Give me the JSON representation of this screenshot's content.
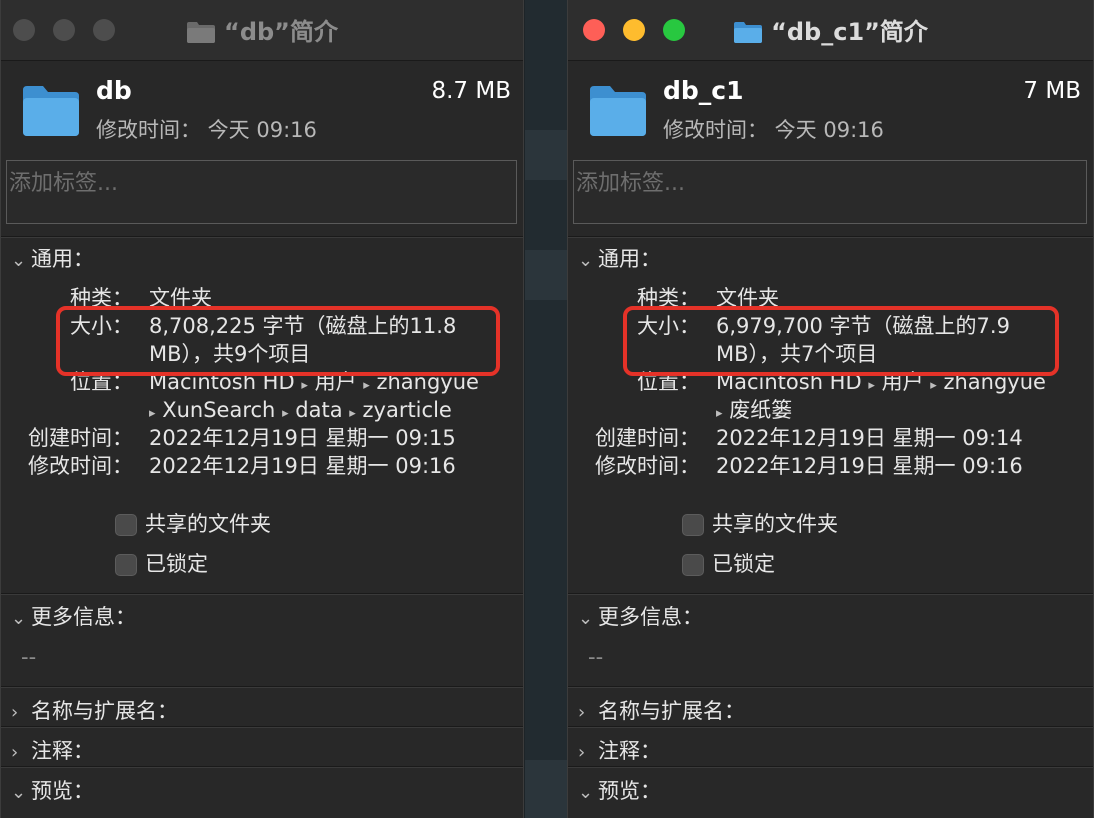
{
  "left": {
    "title": "“db”简介",
    "name": "db",
    "size": "8.7 MB",
    "modified_header": "修改时间： 今天 09:16",
    "tags_placeholder": "添加标签...",
    "general_label": "通用：",
    "kind_label": "种类：",
    "kind_value": "文件夹",
    "size_label": "大小：",
    "size_line1": "8,708,225 字节（磁盘上的11.8",
    "size_line2": "MB），共9个项目",
    "where_label": "位置：",
    "where_line1_a": "Macintosh HD",
    "where_line1_b": "用户",
    "where_line1_c": "zhangyue",
    "where_line2_a": "XunSearch",
    "where_line2_b": "data",
    "where_line2_c": "zyarticle",
    "created_label": "创建时间：",
    "created_value": "2022年12月19日 星期一 09:15",
    "modified_label": "修改时间：",
    "modified_value": "2022年12月19日 星期一 09:16",
    "shared_folder": "共享的文件夹",
    "locked": "已锁定",
    "more_info": "更多信息：",
    "more_info_value": "--",
    "name_ext": "名称与扩展名：",
    "comments": "注释：",
    "preview": "预览："
  },
  "right": {
    "title": "“db_c1”简介",
    "name": "db_c1",
    "size": "7 MB",
    "modified_header": "修改时间： 今天 09:16",
    "tags_placeholder": "添加标签...",
    "general_label": "通用：",
    "kind_label": "种类：",
    "kind_value": "文件夹",
    "size_label": "大小：",
    "size_line1": "6,979,700 字节（磁盘上的7.9",
    "size_line2": "MB），共7个项目",
    "where_label": "位置：",
    "where_line1_a": "Macintosh HD",
    "where_line1_b": "用户",
    "where_line1_c": "zhangyue",
    "where_line2_a": "废纸篓",
    "created_label": "创建时间：",
    "created_value": "2022年12月19日 星期一 09:14",
    "modified_label": "修改时间：",
    "modified_value": "2022年12月19日 星期一 09:16",
    "shared_folder": "共享的文件夹",
    "locked": "已锁定",
    "more_info": "更多信息：",
    "more_info_value": "--",
    "name_ext": "名称与扩展名：",
    "comments": "注释：",
    "preview": "预览："
  },
  "colors": {
    "highlight": "#e53228",
    "traffic_close": "#fe5f57",
    "traffic_min": "#febc2e",
    "traffic_max": "#28c840",
    "folder": "#5aaee9"
  },
  "icons": [
    "folder-icon",
    "chevron-down-icon",
    "chevron-right-icon",
    "path-arrow-icon",
    "checkbox"
  ]
}
